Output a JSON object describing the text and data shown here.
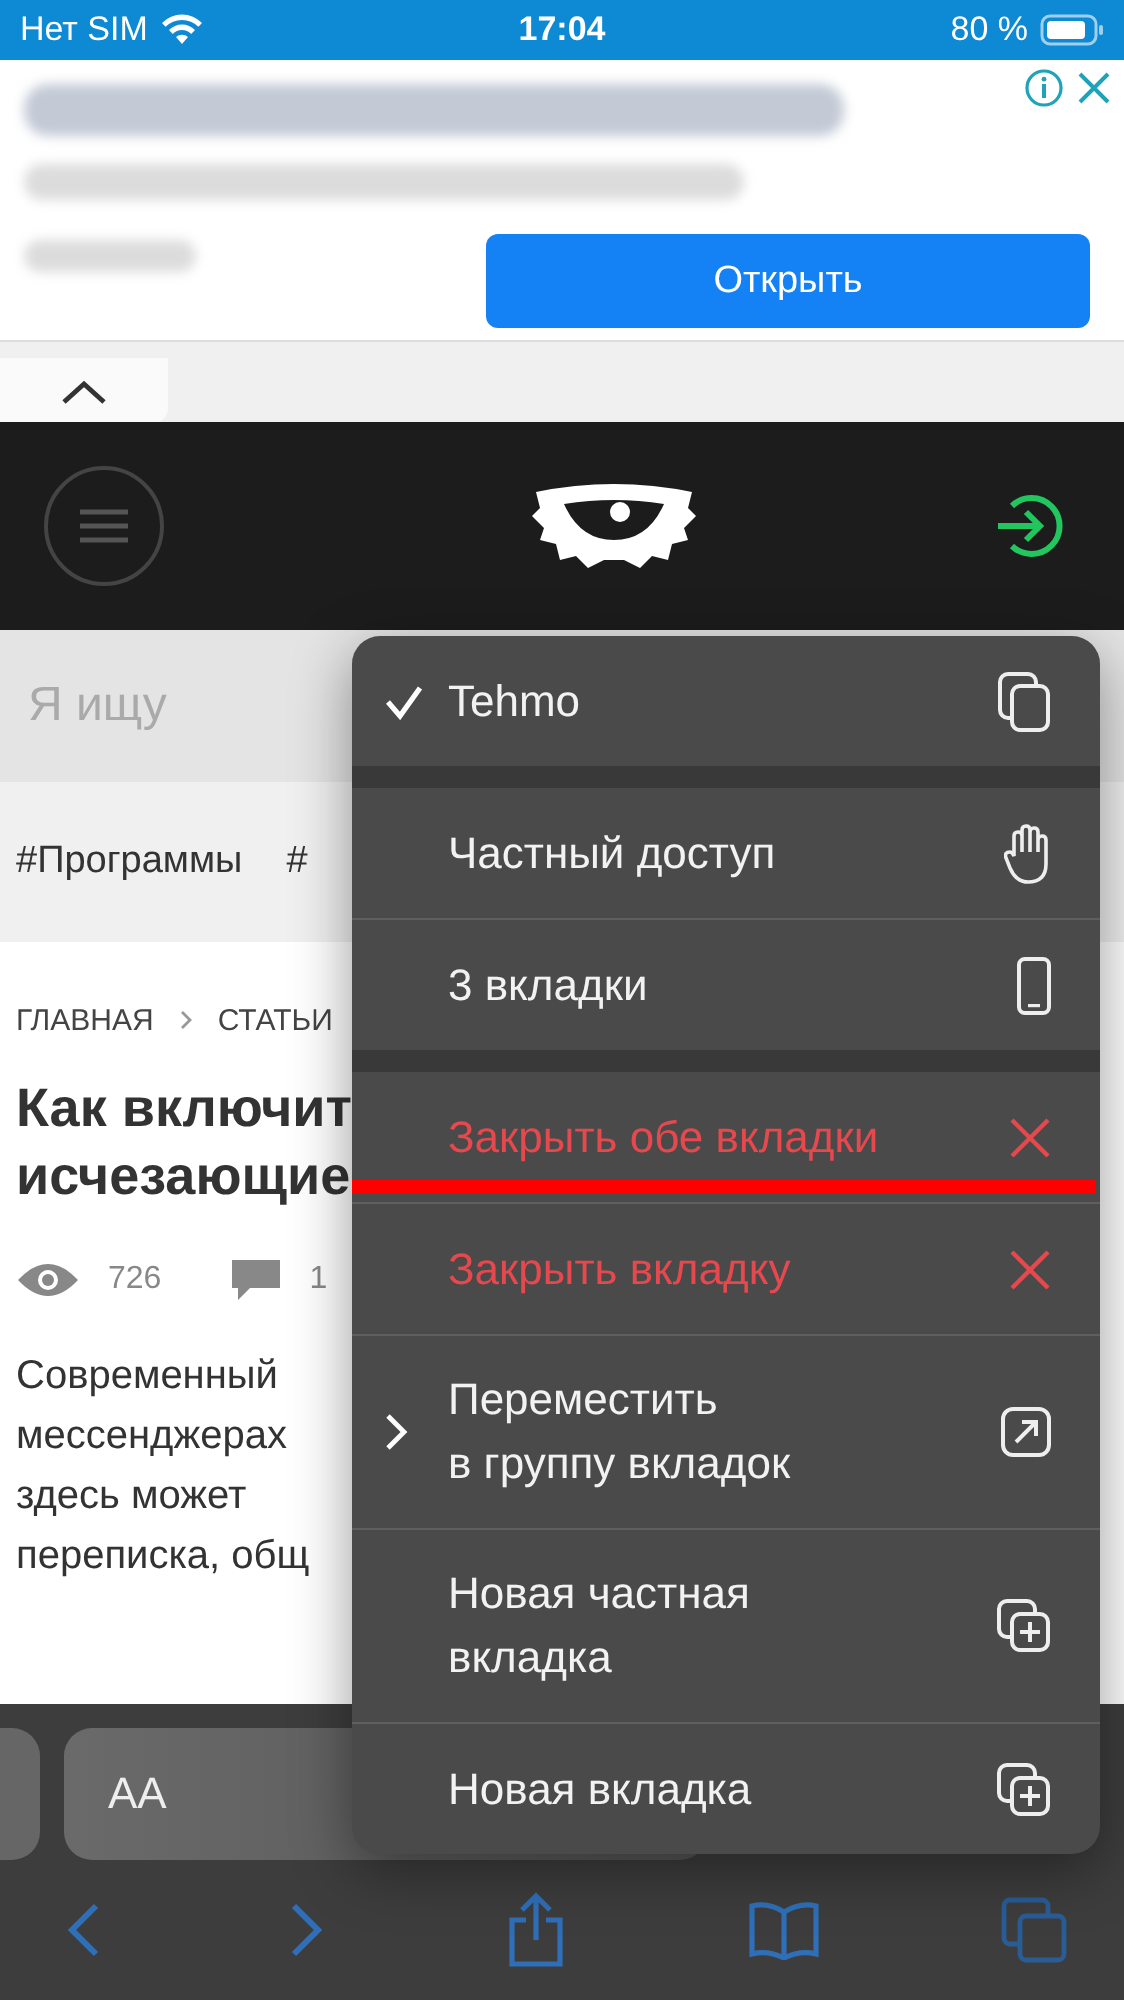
{
  "status_bar": {
    "carrier": "Нет SIM",
    "time": "17:04",
    "battery": "80 %"
  },
  "ad": {
    "button": "Открыть"
  },
  "search": {
    "placeholder": "Я ищу"
  },
  "tags": [
    "#Программы",
    "#"
  ],
  "breadcrumb": [
    "ГЛАВНАЯ",
    "СТАТЬИ"
  ],
  "article": {
    "title_lines": [
      "Как включит",
      "исчезающие"
    ],
    "views": "726",
    "comments": "1",
    "lines": [
      "Современный",
      "мессенджерах",
      "здесь может",
      "переписка, общ"
    ]
  },
  "toolbar": {
    "text_size": "AA"
  },
  "menu": {
    "groups": [
      {
        "items": [
          {
            "label": "Tehmo",
            "kind": "normal",
            "checked": true,
            "underlined": false
          }
        ]
      },
      {
        "items": [
          {
            "label": "Частный доступ",
            "kind": "normal",
            "checked": false,
            "underlined": false
          },
          {
            "label": "3 вкладки",
            "kind": "normal",
            "checked": false,
            "underlined": false
          }
        ]
      },
      {
        "items": [
          {
            "label": "Закрыть обе вкладки",
            "kind": "destructive",
            "checked": false,
            "underlined": true
          },
          {
            "label": "Закрыть вкладку",
            "kind": "destructive",
            "checked": false,
            "underlined": false
          },
          {
            "label": "Переместить\nв группу вкладок",
            "kind": "submenu",
            "checked": false,
            "underlined": false
          },
          {
            "label": "Новая частная\nвкладка",
            "kind": "normal",
            "checked": false,
            "underlined": false
          },
          {
            "label": "Новая вкладка",
            "kind": "normal",
            "checked": false,
            "underlined": false
          }
        ]
      }
    ]
  }
}
